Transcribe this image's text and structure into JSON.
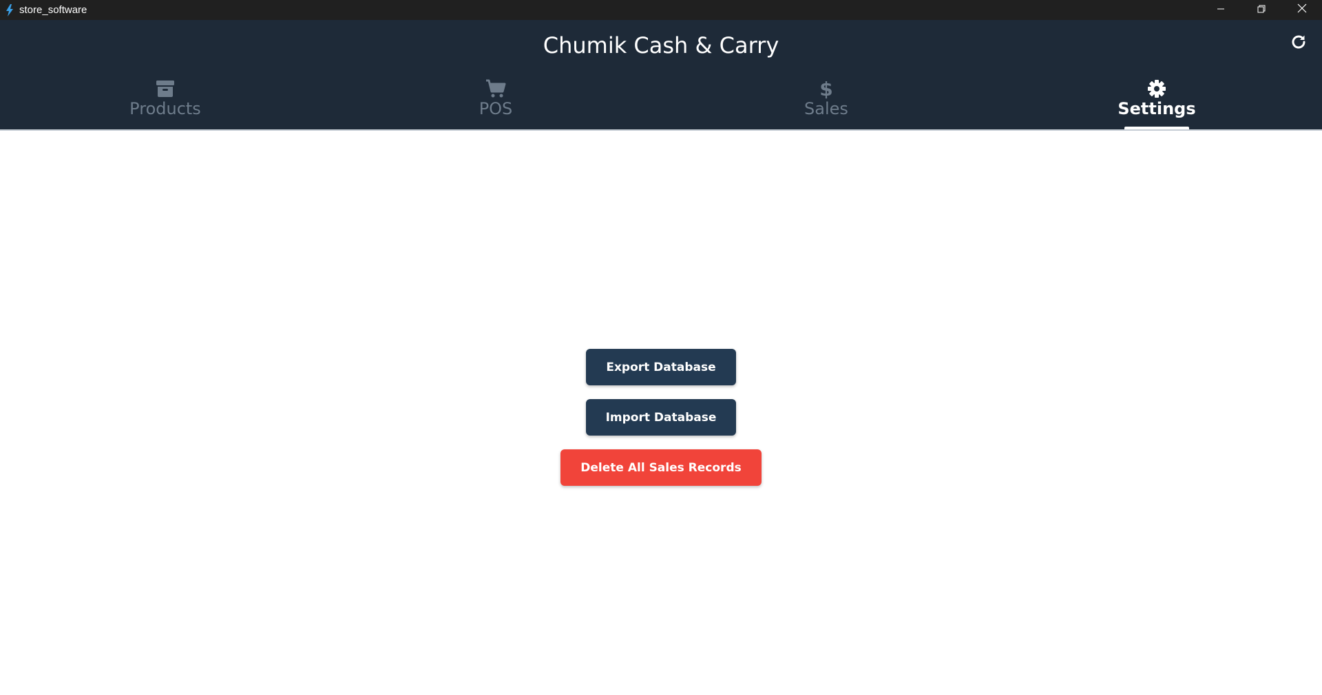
{
  "window": {
    "title": "store_software",
    "controls": [
      "minimize-icon",
      "restore-icon",
      "close-icon"
    ]
  },
  "header": {
    "title": "Chumik Cash & Carry",
    "refresh_icon": "refresh-icon"
  },
  "tabs": [
    {
      "label": "Products",
      "icon": "archive-box-icon",
      "active": false
    },
    {
      "label": "POS",
      "icon": "shopping-cart-icon",
      "active": false
    },
    {
      "label": "Sales",
      "icon": "dollar-icon",
      "active": false
    },
    {
      "label": "Settings",
      "icon": "gear-icon",
      "active": true
    }
  ],
  "settings": {
    "export_label": "Export Database",
    "import_label": "Import Database",
    "delete_label": "Delete All Sales Records"
  },
  "colors": {
    "titlebar": "#202020",
    "header": "#1e2a38",
    "tab_inactive": "#6e7c8b",
    "tab_active": "#ffffff",
    "button_dark": "#233a52",
    "button_danger": "#f1443a"
  }
}
